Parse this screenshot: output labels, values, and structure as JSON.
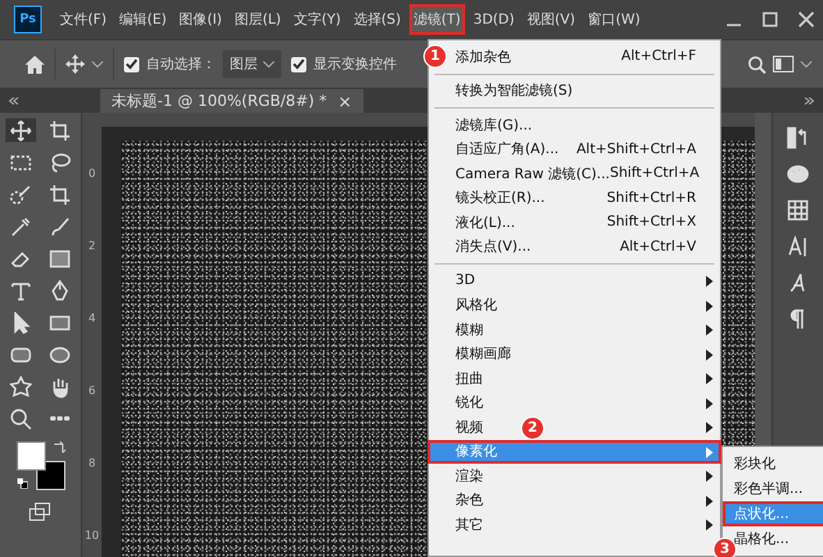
{
  "menubar": {
    "app_icon": "Ps",
    "items": [
      {
        "label": "文件(F)",
        "selected": false,
        "boxed": false
      },
      {
        "label": "编辑(E)",
        "selected": false,
        "boxed": false
      },
      {
        "label": "图像(I)",
        "selected": false,
        "boxed": false
      },
      {
        "label": "图层(L)",
        "selected": false,
        "boxed": false
      },
      {
        "label": "文字(Y)",
        "selected": false,
        "boxed": false
      },
      {
        "label": "选择(S)",
        "selected": false,
        "boxed": false
      },
      {
        "label": "滤镜(T)",
        "selected": true,
        "boxed": true,
        "callout": "1"
      },
      {
        "label": "3D(D)",
        "selected": false,
        "boxed": false
      },
      {
        "label": "视图(V)",
        "selected": false,
        "boxed": false
      },
      {
        "label": "窗口(W)",
        "selected": false,
        "boxed": false
      }
    ]
  },
  "options_bar": {
    "auto_select": {
      "label": "自动选择：",
      "checked": true
    },
    "layer_dropdown": {
      "value": "图层"
    },
    "show_transform": {
      "label": "显示变换控件",
      "checked": true
    }
  },
  "document_tab": {
    "title": "未标题-1 @ 100%(RGB/8#) *",
    "close": "×"
  },
  "ruler_labels": [
    "0",
    "2",
    "4",
    "6",
    "8",
    "10"
  ],
  "tools": [
    {
      "kind": "move",
      "selected": true
    },
    {
      "kind": "artboard",
      "selected": false
    },
    {
      "kind": "marquee",
      "selected": false
    },
    {
      "kind": "lasso",
      "selected": false
    },
    {
      "kind": "quick-select",
      "selected": false
    },
    {
      "kind": "crop",
      "selected": false
    },
    {
      "kind": "eyedropper",
      "selected": false
    },
    {
      "kind": "brush",
      "selected": false
    },
    {
      "kind": "eraser",
      "selected": false
    },
    {
      "kind": "gradient",
      "selected": false
    },
    {
      "kind": "type",
      "selected": false
    },
    {
      "kind": "pen",
      "selected": false
    },
    {
      "kind": "pointer",
      "selected": false
    },
    {
      "kind": "rectangle",
      "selected": false
    },
    {
      "kind": "rounded-rectangle",
      "selected": false
    },
    {
      "kind": "ellipse",
      "selected": false
    },
    {
      "kind": "shape",
      "selected": false
    },
    {
      "kind": "hand",
      "selected": false
    },
    {
      "kind": "zoom",
      "selected": false
    },
    {
      "kind": "more",
      "selected": false
    }
  ],
  "panel_dock": [
    {
      "kind": "history"
    },
    {
      "kind": "palette"
    },
    {
      "kind": "grid"
    },
    {
      "kind": "character"
    },
    {
      "kind": "glyph"
    },
    {
      "kind": "paragraph"
    }
  ],
  "filter_menu": {
    "items": [
      {
        "kind": "item",
        "label": "添加杂色",
        "shortcut": "Alt+Ctrl+F",
        "selected": false,
        "boxed": false
      },
      {
        "kind": "divider"
      },
      {
        "kind": "item",
        "label": "转换为智能滤镜(S)",
        "selected": false,
        "boxed": false
      },
      {
        "kind": "divider"
      },
      {
        "kind": "item",
        "label": "滤镜库(G)...",
        "selected": false,
        "boxed": false
      },
      {
        "kind": "item",
        "label": "自适应广角(A)...",
        "shortcut": "Alt+Shift+Ctrl+A",
        "selected": false,
        "boxed": false
      },
      {
        "kind": "item",
        "label": "Camera Raw 滤镜(C)...",
        "shortcut": "Shift+Ctrl+A",
        "selected": false,
        "boxed": false
      },
      {
        "kind": "item",
        "label": "镜头校正(R)...",
        "shortcut": "Shift+Ctrl+R",
        "selected": false,
        "boxed": false
      },
      {
        "kind": "item",
        "label": "液化(L)...",
        "shortcut": "Shift+Ctrl+X",
        "selected": false,
        "boxed": false
      },
      {
        "kind": "item",
        "label": "消失点(V)...",
        "shortcut": "Alt+Ctrl+V",
        "selected": false,
        "boxed": false
      },
      {
        "kind": "divider"
      },
      {
        "kind": "submenu",
        "label": "3D",
        "selected": false,
        "boxed": false
      },
      {
        "kind": "submenu",
        "label": "风格化",
        "selected": false,
        "boxed": false
      },
      {
        "kind": "submenu",
        "label": "模糊",
        "selected": false,
        "boxed": false
      },
      {
        "kind": "submenu",
        "label": "模糊画廊",
        "selected": false,
        "boxed": false
      },
      {
        "kind": "submenu",
        "label": "扭曲",
        "selected": false,
        "boxed": false
      },
      {
        "kind": "submenu",
        "label": "锐化",
        "selected": false,
        "boxed": false
      },
      {
        "kind": "submenu",
        "label": "视频",
        "selected": false,
        "boxed": false
      },
      {
        "kind": "submenu",
        "label": "像素化",
        "selected": true,
        "boxed": true,
        "callout": "2"
      },
      {
        "kind": "submenu",
        "label": "渲染",
        "selected": false,
        "boxed": false
      },
      {
        "kind": "submenu",
        "label": "杂色",
        "selected": false,
        "boxed": false
      },
      {
        "kind": "submenu",
        "label": "其它",
        "selected": false,
        "boxed": false
      }
    ]
  },
  "pixelate_submenu": {
    "items": [
      {
        "label": "彩块化",
        "selected": false,
        "boxed": false
      },
      {
        "label": "彩色半调...",
        "selected": false,
        "boxed": false
      },
      {
        "label": "点状化...",
        "selected": true,
        "boxed": true,
        "callout": "3"
      },
      {
        "label": "晶格化...",
        "selected": false,
        "boxed": false
      }
    ]
  }
}
